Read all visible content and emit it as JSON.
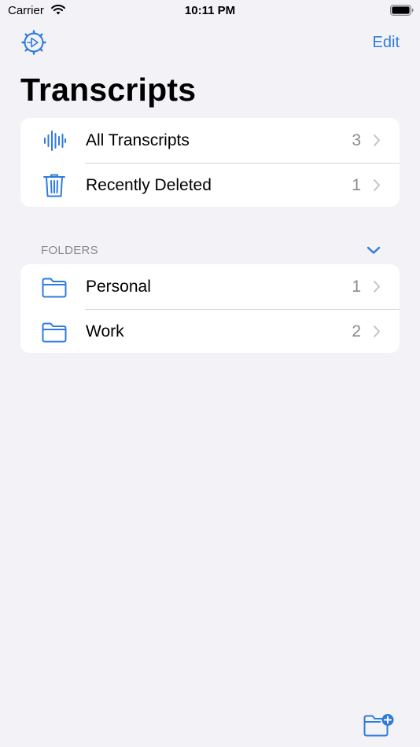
{
  "status_bar": {
    "carrier": "Carrier",
    "time": "10:11 PM"
  },
  "nav": {
    "settings_icon": "settings-gear-icon",
    "edit_label": "Edit",
    "title": "Transcripts"
  },
  "library": {
    "items": [
      {
        "label": "All Transcripts",
        "count": "3",
        "icon": "waveform-icon"
      },
      {
        "label": "Recently Deleted",
        "count": "1",
        "icon": "trash-icon"
      }
    ]
  },
  "folders": {
    "header": "FOLDERS",
    "collapse_icon": "chevron-down-icon",
    "items": [
      {
        "label": "Personal",
        "count": "1",
        "icon": "folder-icon"
      },
      {
        "label": "Work",
        "count": "2",
        "icon": "folder-icon"
      }
    ]
  },
  "toolbar": {
    "new_folder_icon": "new-folder-icon"
  },
  "colors": {
    "accent": "#2f7bdc",
    "background": "#f2f2f7",
    "secondary_text": "#8a8a8e"
  }
}
